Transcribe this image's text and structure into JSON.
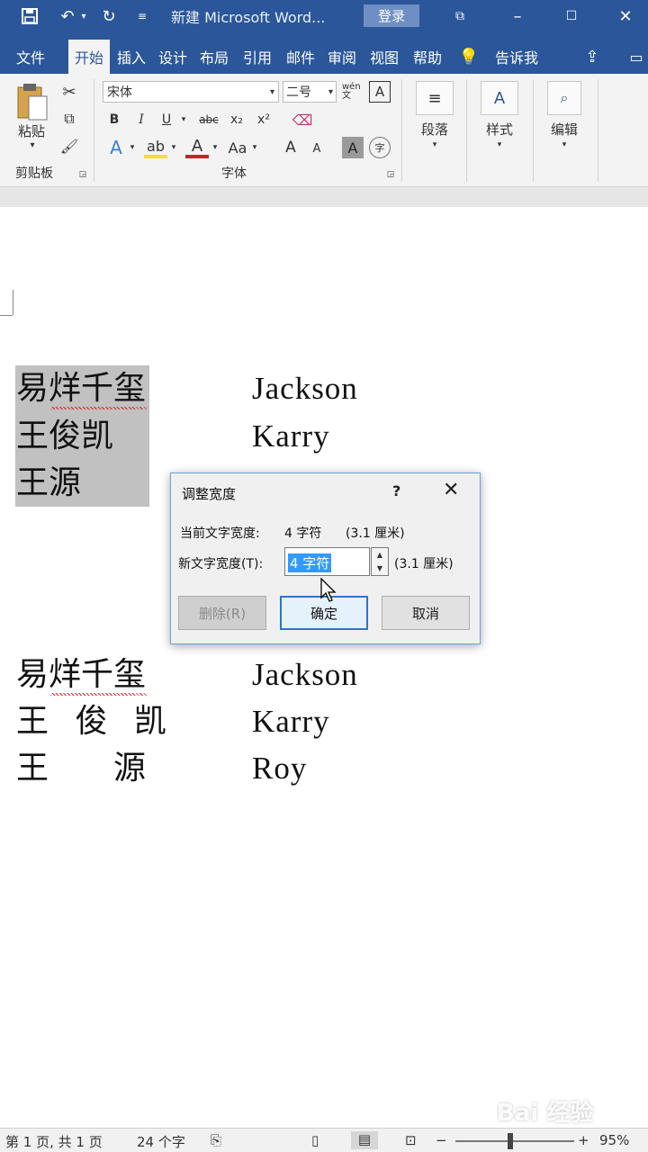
{
  "titlebar": {
    "title": "新建 Microsoft Word...",
    "login": "登录"
  },
  "tabs": [
    "文件",
    "开始",
    "插入",
    "设计",
    "布局",
    "引用",
    "邮件",
    "审阅",
    "视图",
    "帮助"
  ],
  "tell_me": "告诉我",
  "ribbon": {
    "paste": "粘贴",
    "clipboard_group": "剪贴板",
    "font_name": "宋体",
    "font_size": "二号",
    "font_group": "字体",
    "bold": "B",
    "italic": "I",
    "underline": "U",
    "strike": "abc",
    "subscript": "x₂",
    "superscript": "x²",
    "change_case": "Aa",
    "grow_font": "A",
    "shrink_font": "A",
    "char_shading": "A",
    "enclose": "字",
    "wen": "wén文",
    "paragraph": "段落",
    "styles": "样式",
    "editing": "编辑"
  },
  "document": {
    "group1_cjk": [
      "易烊千玺",
      "王俊凯",
      "王源"
    ],
    "group1_latin": [
      "Jackson",
      "Karry"
    ],
    "group2_cjk": [
      "易烊千玺",
      "王 俊 凯",
      "王　　源"
    ],
    "group2_latin": [
      "Jackson",
      "Karry",
      "Roy"
    ]
  },
  "dialog": {
    "title": "调整宽度",
    "help": "?",
    "current_label": "当前文字宽度:",
    "current_value": "4 字符",
    "current_cm": "(3.1 厘米)",
    "new_label": "新文字宽度(T):",
    "new_value": "4 字符",
    "new_cm": "(3.1 厘米)",
    "delete": "删除(R)",
    "ok": "确定",
    "cancel": "取消"
  },
  "statusbar": {
    "page": "第 1 页, 共 1 页",
    "words": "24 个字",
    "zoom": "95%"
  },
  "watermark": "Bai 经验",
  "colors": {
    "word_blue": "#2b579a",
    "selection": "#c1c1c1",
    "input_highlight": "#3399ff"
  }
}
